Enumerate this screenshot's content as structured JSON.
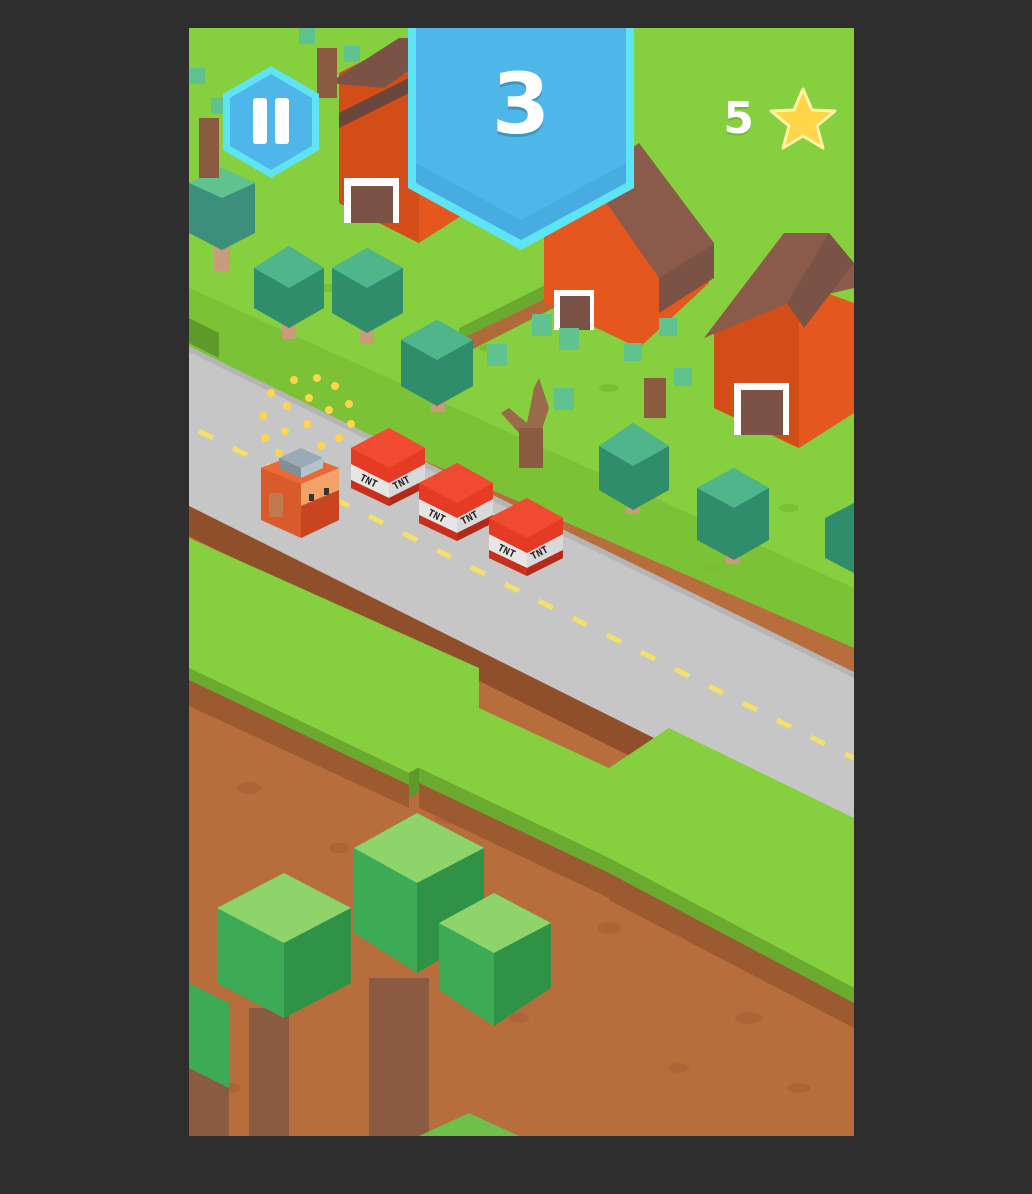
{
  "hud": {
    "score": "3",
    "stars_count": "5",
    "pause_icon": "pause-icon",
    "star_icon": "star-icon"
  },
  "world": {
    "obstacles": [
      {
        "kind": "tnt-block",
        "label_left": "TNT",
        "label_right": "TNT"
      },
      {
        "kind": "tnt-block",
        "label_left": "TNT",
        "label_right": "TNT"
      },
      {
        "kind": "tnt-block",
        "label_left": "TNT",
        "label_right": "TNT"
      }
    ],
    "player": "lumberjack-character"
  },
  "colors": {
    "frame_bg": "#2e2e2e",
    "sky": "#7fc7ef",
    "grass_top": "#86cf3e",
    "grass_side": "#6aab2f",
    "dirt": "#b86d3c",
    "dirt_dark": "#9b5a30",
    "road": "#c6c6c6",
    "road_line": "#f3e06a",
    "barn_red": "#e4571e",
    "barn_roof": "#7b5346",
    "tnt_red": "#e53a23",
    "hud_blue": "#4fb6ea",
    "hud_blue_border": "#5fe4f6",
    "star_yellow": "#ffd54a"
  }
}
